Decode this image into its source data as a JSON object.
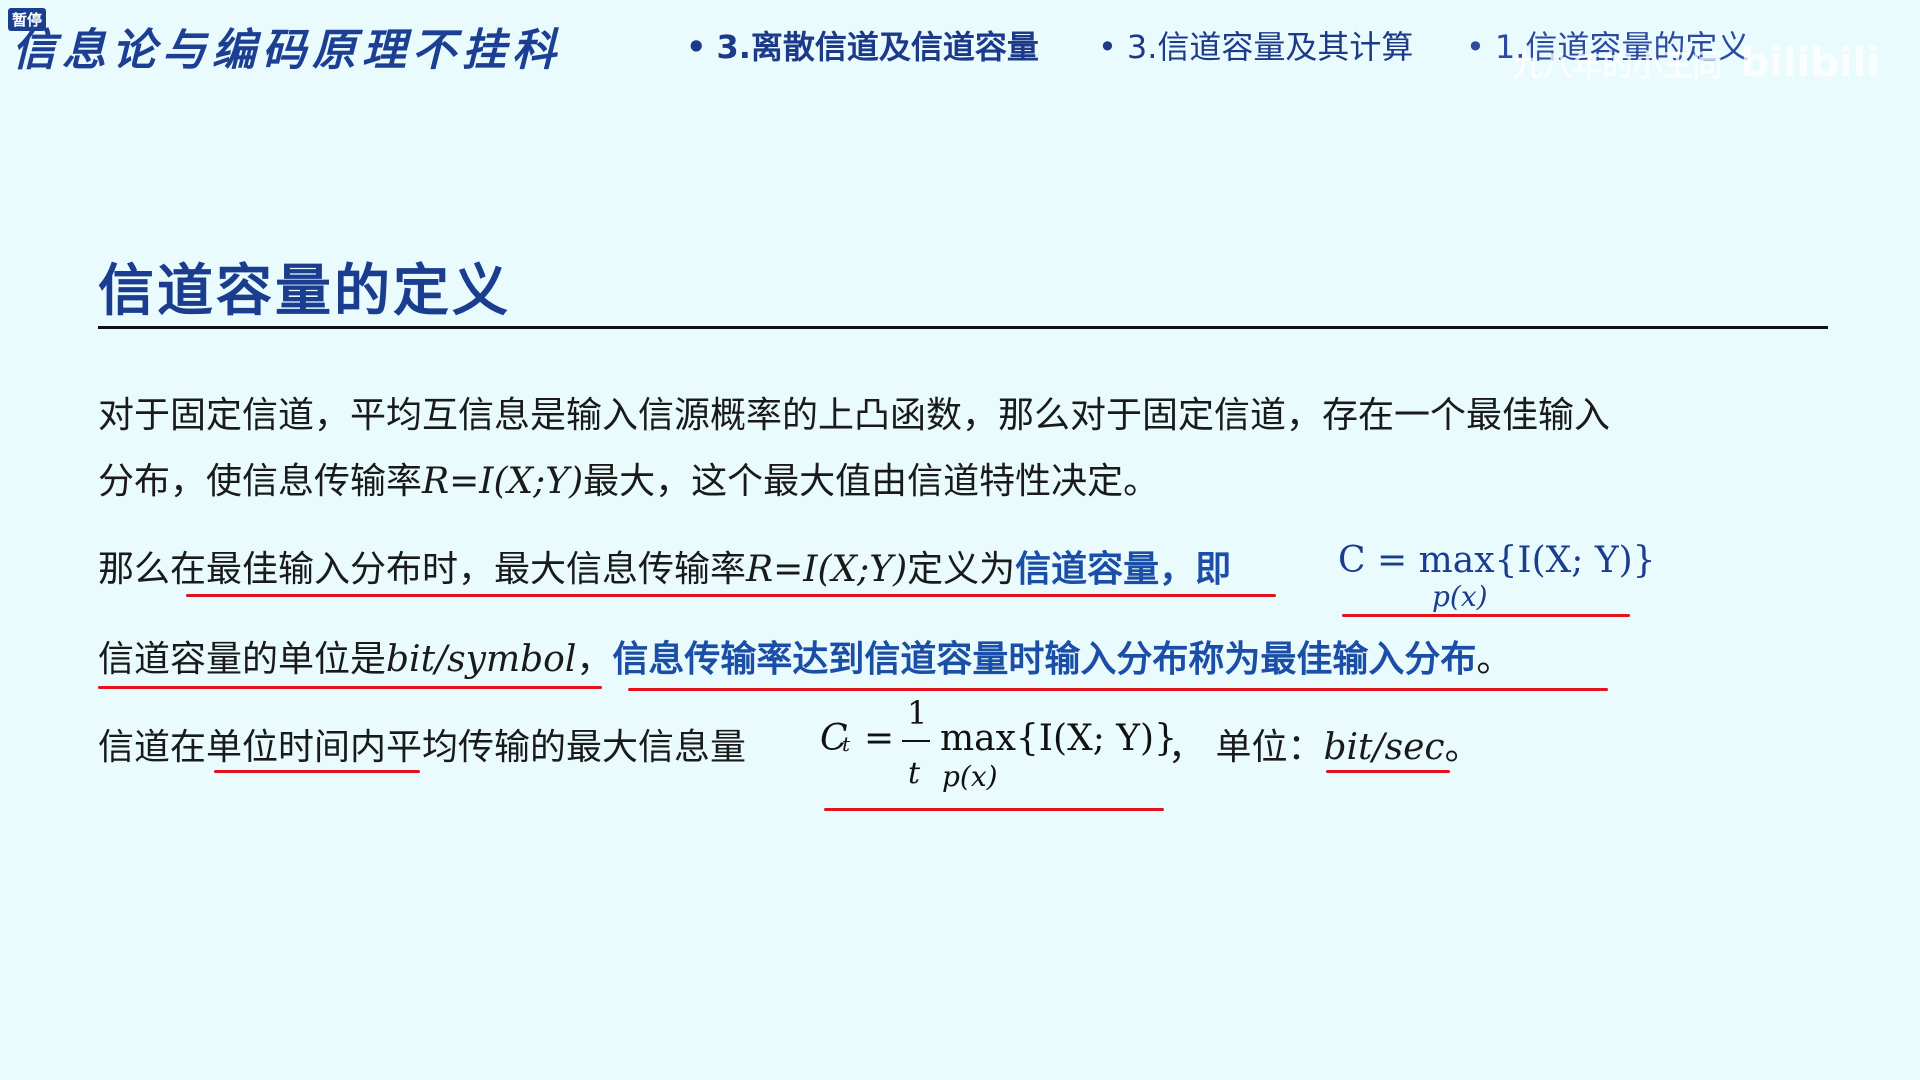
{
  "header": {
    "badge": "暂停",
    "series_title": "信息论与编码原理不挂科",
    "breadcrumbs": [
      "3.离散信道及信道容量",
      "3.信道容量及其计算",
      "1.信道容量的定义"
    ],
    "watermark": "九八年的小王同",
    "watermark_logo": "bilibili"
  },
  "slide": {
    "title": "信道容量的定义",
    "p1": "对于固定信道，平均互信息是输入信源概率的上凸函数，那么对于固定信道，存在一个最佳输入",
    "p2_a": "分布，使信息传输率",
    "p2_math": "R=I(X;Y)",
    "p2_b": "最大，这个最大值由信道特性决定。",
    "p3_a": "那么在最佳输入分布时，最大信息传输率",
    "p3_math": "R=I(X;Y)",
    "p3_b": "定义为",
    "p3_blue": "信道容量，即",
    "f1_main": "C = max{I(X; Y)}",
    "f1_sub": "p(x)",
    "p4_a": "信道容量的单位是",
    "p4_math": "bit/symbol",
    "p4_b": "，",
    "p4_blue": "信息传输率达到信道容量时输入分布称为最佳输入分布",
    "p4_c": "。",
    "p5_a": "信道在单位时间内平均传输的最大信息量",
    "f2_c": "C",
    "f2_t": "t",
    "f2_eq": "=",
    "f2_num": "1",
    "f2_den": "t",
    "f2_max": "max{I(X; Y)}",
    "f2_sub": "p(x)",
    "unit_label": "，  单位：",
    "unit_value": "bit/sec",
    "unit_end": "。"
  },
  "colors": {
    "accent": "#1b3d8f",
    "underline": "#e3121d",
    "background": "#e9fbfd"
  }
}
